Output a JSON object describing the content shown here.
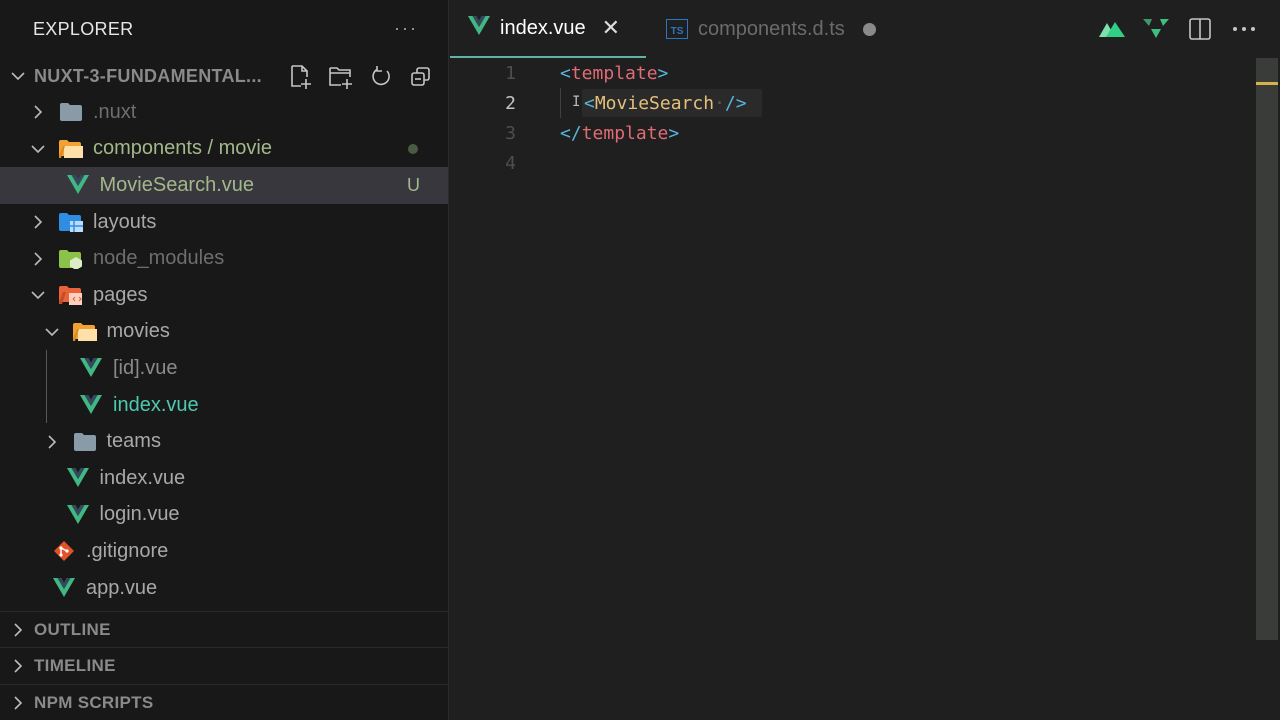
{
  "sidebar": {
    "title": "EXPLORER",
    "more_label": "···",
    "project": {
      "name": "NUXT-3-FUNDAMENTAL...",
      "actions": [
        "new-file",
        "new-folder",
        "refresh",
        "collapse-all"
      ]
    },
    "tree": [
      {
        "label": ".nuxt",
        "type": "folder",
        "icon": "folder-gray-icon",
        "expanded": false,
        "depth": 0,
        "color": "#6e6e6e"
      },
      {
        "label": "components / movie",
        "type": "folder",
        "icon": "folder-components-open-icon",
        "expanded": true,
        "depth": 0,
        "color": "#a3b88a",
        "decoration": "modified-dot"
      },
      {
        "label": "MovieSearch.vue",
        "type": "file",
        "icon": "vue-icon",
        "depth": 1,
        "color": "#a3b88a",
        "badge": "U",
        "selected": true
      },
      {
        "label": "layouts",
        "type": "folder",
        "icon": "folder-layouts-icon",
        "expanded": false,
        "depth": 0,
        "color": "#a8a8a8"
      },
      {
        "label": "node_modules",
        "type": "folder",
        "icon": "folder-node-icon",
        "expanded": false,
        "depth": 0,
        "color": "#6e6e6e"
      },
      {
        "label": "pages",
        "type": "folder",
        "icon": "folder-pages-open-icon",
        "expanded": true,
        "depth": 0,
        "color": "#a8a8a8"
      },
      {
        "label": "movies",
        "type": "folder",
        "icon": "folder-open-icon",
        "expanded": true,
        "depth": 1,
        "color": "#a8a8a8"
      },
      {
        "label": "[id].vue",
        "type": "file",
        "icon": "vue-icon",
        "depth": 2,
        "color": "#8a8a8a"
      },
      {
        "label": "index.vue",
        "type": "file",
        "icon": "vue-icon",
        "depth": 2,
        "color": "#4ec9b0"
      },
      {
        "label": "teams",
        "type": "folder",
        "icon": "folder-gray-icon",
        "expanded": false,
        "depth": 1,
        "color": "#a8a8a8"
      },
      {
        "label": "index.vue",
        "type": "file",
        "icon": "vue-icon",
        "depth": 1,
        "color": "#a8a8a8"
      },
      {
        "label": "login.vue",
        "type": "file",
        "icon": "vue-icon",
        "depth": 1,
        "color": "#a8a8a8"
      },
      {
        "label": ".gitignore",
        "type": "file",
        "icon": "git-icon",
        "depth": 0,
        "color": "#a8a8a8"
      },
      {
        "label": "app.vue",
        "type": "file",
        "icon": "vue-icon",
        "depth": 0,
        "color": "#a8a8a8"
      }
    ],
    "sections": [
      "OUTLINE",
      "TIMELINE",
      "NPM SCRIPTS"
    ]
  },
  "tabs": [
    {
      "label": "index.vue",
      "icon": "vue-icon",
      "active": true,
      "close": "✕"
    },
    {
      "label": "components.d.ts",
      "icon": "typescript-icon",
      "icon_text": "TS",
      "active": false,
      "dirty": true
    }
  ],
  "top_actions": [
    "nuxt-icon",
    "vitest-icon",
    "split-editor-icon",
    "more-actions-icon"
  ],
  "editor": {
    "current_line": 2,
    "lines": [
      {
        "num": "1",
        "tokens": [
          {
            "t": "<",
            "c": "punc"
          },
          {
            "t": "template",
            "c": "tag"
          },
          {
            "t": ">",
            "c": "punc"
          }
        ]
      },
      {
        "num": "2",
        "tokens": [
          {
            "t": "<",
            "c": "punc"
          },
          {
            "t": "MovieSearch",
            "c": "comp"
          },
          {
            "t": "·",
            "c": "ws"
          },
          {
            "t": "/>",
            "c": "punc"
          }
        ]
      },
      {
        "num": "3",
        "tokens": [
          {
            "t": "</",
            "c": "punc"
          },
          {
            "t": "template",
            "c": "tag"
          },
          {
            "t": ">",
            "c": "punc"
          }
        ]
      },
      {
        "num": "4",
        "tokens": []
      }
    ]
  },
  "colors": {
    "accent": "#5fb3a0",
    "vue_green": "#41b883",
    "vue_dark": "#35495e",
    "untracked": "#a3b88a",
    "scroll_marker": "#d4b44a"
  }
}
